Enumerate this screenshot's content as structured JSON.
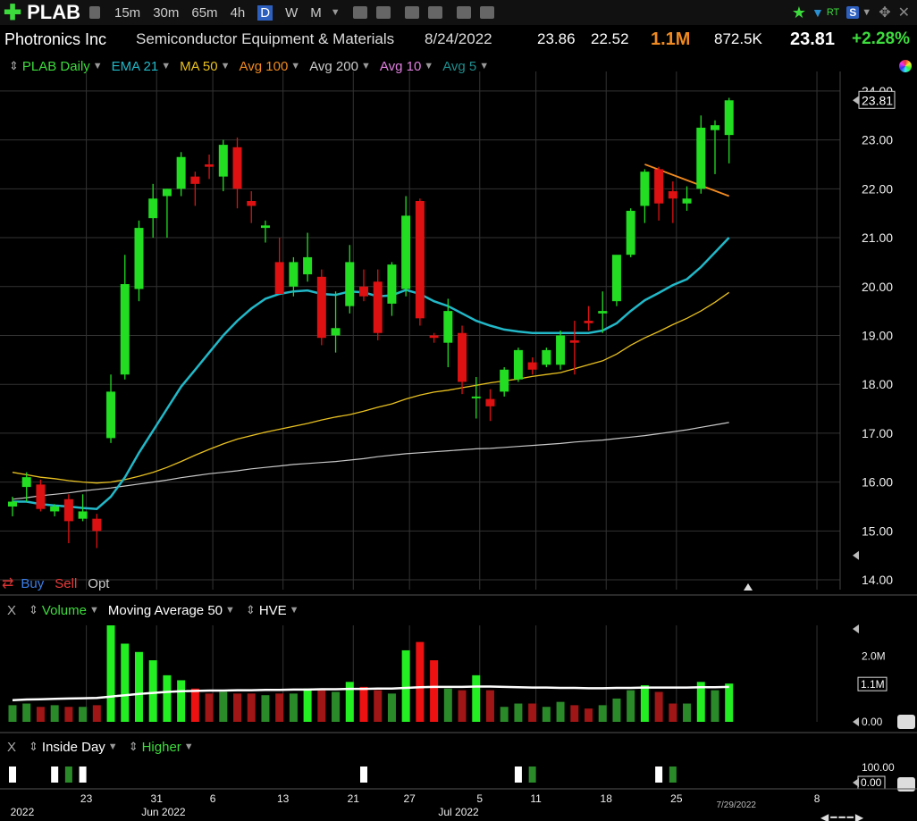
{
  "toolbar": {
    "symbol": "PLAB",
    "timeframes": [
      {
        "label": "15m",
        "active": false
      },
      {
        "label": "30m",
        "active": false
      },
      {
        "label": "65m",
        "active": false
      },
      {
        "label": "4h",
        "active": false
      },
      {
        "label": "D",
        "active": true
      },
      {
        "label": "W",
        "active": false
      },
      {
        "label": "M",
        "active": false
      }
    ],
    "rt_label": "RT",
    "s_label": "S"
  },
  "quote": {
    "company": "Photronics Inc",
    "industry": "Semiconductor Equipment & Materials",
    "date": "8/24/2022",
    "high": "23.86",
    "low": "22.52",
    "volume": "1.1M",
    "avg_volume": "872.5K",
    "last": "23.81",
    "change": "+2.28%"
  },
  "studies": [
    {
      "label": "PLAB Daily",
      "color": "#3ddc3d"
    },
    {
      "label": "EMA 21",
      "color": "#22b8c8"
    },
    {
      "label": "MA 50",
      "color": "#e8c020"
    },
    {
      "label": "Avg 100",
      "color": "#f08a20"
    },
    {
      "label": "Avg 200",
      "color": "#cccccc"
    },
    {
      "label": "Avg 10",
      "color": "#e080e0"
    },
    {
      "label": "Avg 5",
      "color": "#1f8f8f"
    }
  ],
  "orders": {
    "buy": "Buy",
    "sell": "Sell",
    "opt": "Opt"
  },
  "volume_header": {
    "x": "X",
    "volume": "Volume",
    "ma": "Moving Average 50",
    "hve": "HVE"
  },
  "indicator_header": {
    "x": "X",
    "inside": "Inside Day",
    "higher": "Higher"
  },
  "colors": {
    "up": "#22dd22",
    "down": "#dd1111",
    "ema21": "#22b8c8",
    "ma50": "#e8c020",
    "avg200": "#c8c8c8",
    "trend": "#f08a20",
    "grid": "#333333"
  },
  "chart_data": {
    "type": "candlestick",
    "ylim": [
      13.8,
      24.4
    ],
    "y_ticks": [
      14,
      15,
      16,
      17,
      18,
      19,
      20,
      21,
      22,
      23,
      24
    ],
    "y_tick_labels": [
      "14.00",
      "15.00",
      "16.00",
      "17.00",
      "18.00",
      "19.00",
      "20.00",
      "21.00",
      "22.00",
      "23.00",
      "24.00"
    ],
    "last_price_label": "23.81",
    "x_labels": [
      {
        "label": "23",
        "i": 5
      },
      {
        "label": "31",
        "i": 10
      },
      {
        "label": "6",
        "i": 14
      },
      {
        "label": "13",
        "i": 19
      },
      {
        "label": "21",
        "i": 24
      },
      {
        "label": "27",
        "i": 28
      },
      {
        "label": "5",
        "i": 33
      },
      {
        "label": "11",
        "i": 37
      },
      {
        "label": "18",
        "i": 42
      },
      {
        "label": "25",
        "i": 47
      },
      {
        "label": "8",
        "i": 57
      }
    ],
    "sub_labels": [
      {
        "label": "2022",
        "i": 0.1
      },
      {
        "label": "Jun 2022",
        "i": 11
      },
      {
        "label": "Jul 2022",
        "i": 32
      },
      {
        "label": "7/29/2022",
        "i": 51
      }
    ],
    "candles": [
      {
        "o": 15.5,
        "h": 15.7,
        "l": 15.3,
        "c": 15.6
      },
      {
        "o": 15.9,
        "h": 16.2,
        "l": 15.6,
        "c": 16.1
      },
      {
        "o": 15.95,
        "h": 16.05,
        "l": 15.4,
        "c": 15.45
      },
      {
        "o": 15.4,
        "h": 15.55,
        "l": 15.3,
        "c": 15.5
      },
      {
        "o": 15.65,
        "h": 15.75,
        "l": 14.75,
        "c": 15.2
      },
      {
        "o": 15.25,
        "h": 15.75,
        "l": 15.2,
        "c": 15.4
      },
      {
        "o": 15.25,
        "h": 15.35,
        "l": 14.65,
        "c": 15.0
      },
      {
        "o": 16.9,
        "h": 18.2,
        "l": 16.8,
        "c": 17.85
      },
      {
        "o": 18.2,
        "h": 20.65,
        "l": 18.1,
        "c": 20.05
      },
      {
        "o": 19.95,
        "h": 21.35,
        "l": 19.7,
        "c": 21.2
      },
      {
        "o": 21.4,
        "h": 22.1,
        "l": 21.0,
        "c": 21.8
      },
      {
        "o": 21.85,
        "h": 22.0,
        "l": 21.0,
        "c": 22.0
      },
      {
        "o": 22.0,
        "h": 22.75,
        "l": 21.85,
        "c": 22.65
      },
      {
        "o": 22.25,
        "h": 22.35,
        "l": 21.65,
        "c": 22.1
      },
      {
        "o": 22.5,
        "h": 22.7,
        "l": 22.2,
        "c": 22.45
      },
      {
        "o": 22.25,
        "h": 23.0,
        "l": 21.95,
        "c": 22.9
      },
      {
        "o": 22.85,
        "h": 23.05,
        "l": 21.6,
        "c": 22.0
      },
      {
        "o": 21.75,
        "h": 21.95,
        "l": 21.3,
        "c": 21.65
      },
      {
        "o": 21.2,
        "h": 21.35,
        "l": 20.9,
        "c": 21.25
      },
      {
        "o": 20.5,
        "h": 21.0,
        "l": 19.85,
        "c": 19.85
      },
      {
        "o": 20.0,
        "h": 20.6,
        "l": 19.8,
        "c": 20.5
      },
      {
        "o": 20.25,
        "h": 21.1,
        "l": 20.1,
        "c": 20.6
      },
      {
        "o": 20.2,
        "h": 20.35,
        "l": 18.8,
        "c": 18.95
      },
      {
        "o": 19.0,
        "h": 19.9,
        "l": 18.65,
        "c": 19.15
      },
      {
        "o": 19.6,
        "h": 20.85,
        "l": 19.45,
        "c": 20.5
      },
      {
        "o": 20.0,
        "h": 20.35,
        "l": 19.7,
        "c": 19.8
      },
      {
        "o": 20.1,
        "h": 20.35,
        "l": 18.9,
        "c": 19.05
      },
      {
        "o": 19.65,
        "h": 20.5,
        "l": 19.4,
        "c": 20.45
      },
      {
        "o": 19.95,
        "h": 21.85,
        "l": 19.8,
        "c": 21.45
      },
      {
        "o": 21.75,
        "h": 21.8,
        "l": 19.2,
        "c": 19.35
      },
      {
        "o": 19.0,
        "h": 19.05,
        "l": 18.85,
        "c": 18.95
      },
      {
        "o": 18.85,
        "h": 19.75,
        "l": 18.35,
        "c": 19.5
      },
      {
        "o": 19.05,
        "h": 19.2,
        "l": 17.8,
        "c": 18.05
      },
      {
        "o": 17.75,
        "h": 18.15,
        "l": 17.3,
        "c": 17.75
      },
      {
        "o": 17.7,
        "h": 17.9,
        "l": 17.25,
        "c": 17.55
      },
      {
        "o": 17.85,
        "h": 18.35,
        "l": 17.75,
        "c": 18.3
      },
      {
        "o": 18.1,
        "h": 18.75,
        "l": 18.05,
        "c": 18.7
      },
      {
        "o": 18.45,
        "h": 18.55,
        "l": 18.2,
        "c": 18.3
      },
      {
        "o": 18.4,
        "h": 18.75,
        "l": 18.35,
        "c": 18.7
      },
      {
        "o": 18.4,
        "h": 19.1,
        "l": 18.3,
        "c": 19.0
      },
      {
        "o": 18.9,
        "h": 19.3,
        "l": 18.2,
        "c": 18.85
      },
      {
        "o": 19.3,
        "h": 19.6,
        "l": 19.1,
        "c": 19.25
      },
      {
        "o": 19.45,
        "h": 19.9,
        "l": 19.05,
        "c": 19.5
      },
      {
        "o": 19.7,
        "h": 20.55,
        "l": 19.6,
        "c": 20.65
      },
      {
        "o": 20.65,
        "h": 21.6,
        "l": 20.6,
        "c": 21.55
      },
      {
        "o": 21.65,
        "h": 22.4,
        "l": 21.3,
        "c": 22.35
      },
      {
        "o": 22.4,
        "h": 22.45,
        "l": 21.35,
        "c": 21.7
      },
      {
        "o": 21.95,
        "h": 22.15,
        "l": 21.3,
        "c": 21.8
      },
      {
        "o": 21.7,
        "h": 22.05,
        "l": 21.55,
        "c": 21.8
      },
      {
        "o": 22.0,
        "h": 23.5,
        "l": 21.9,
        "c": 23.25
      },
      {
        "o": 23.2,
        "h": 23.4,
        "l": 22.3,
        "c": 23.3
      },
      {
        "o": 23.1,
        "h": 23.86,
        "l": 22.52,
        "c": 23.81
      }
    ],
    "ema21": [
      15.6,
      15.6,
      15.55,
      15.52,
      15.5,
      15.47,
      15.45,
      15.7,
      16.1,
      16.6,
      17.05,
      17.5,
      17.95,
      18.3,
      18.65,
      19.0,
      19.3,
      19.55,
      19.75,
      19.85,
      19.9,
      19.92,
      19.85,
      19.83,
      19.9,
      19.88,
      19.8,
      19.82,
      19.93,
      19.85,
      19.7,
      19.6,
      19.45,
      19.3,
      19.2,
      19.12,
      19.08,
      19.05,
      19.05,
      19.05,
      19.05,
      19.05,
      19.1,
      19.25,
      19.5,
      19.72,
      19.87,
      20.03,
      20.15,
      20.4,
      20.7,
      21.0
    ],
    "ma50": [
      16.2,
      16.15,
      16.1,
      16.07,
      16.03,
      16.0,
      15.98,
      16.0,
      16.05,
      16.12,
      16.2,
      16.3,
      16.42,
      16.55,
      16.67,
      16.78,
      16.88,
      16.95,
      17.02,
      17.08,
      17.14,
      17.2,
      17.27,
      17.33,
      17.38,
      17.45,
      17.53,
      17.6,
      17.7,
      17.78,
      17.84,
      17.88,
      17.93,
      17.98,
      18.03,
      18.07,
      18.11,
      18.16,
      18.2,
      18.24,
      18.32,
      18.4,
      18.48,
      18.62,
      18.8,
      18.95,
      19.08,
      19.22,
      19.35,
      19.5,
      19.68,
      19.88
    ],
    "avg200": [
      15.65,
      15.68,
      15.72,
      15.75,
      15.78,
      15.82,
      15.85,
      15.88,
      15.92,
      15.96,
      16.0,
      16.04,
      16.09,
      16.13,
      16.17,
      16.2,
      16.23,
      16.27,
      16.3,
      16.33,
      16.36,
      16.38,
      16.4,
      16.42,
      16.45,
      16.48,
      16.52,
      16.55,
      16.58,
      16.6,
      16.62,
      16.64,
      16.66,
      16.68,
      16.69,
      16.71,
      16.73,
      16.75,
      16.77,
      16.79,
      16.82,
      16.84,
      16.86,
      16.89,
      16.92,
      16.95,
      16.99,
      17.03,
      17.07,
      17.12,
      17.17,
      17.22
    ],
    "trendline": [
      {
        "i": 45,
        "y": 22.5
      },
      {
        "i": 51,
        "y": 21.85
      }
    ],
    "volume": {
      "ylim": [
        0,
        2.9
      ],
      "y_tick_labels": [
        "0.00",
        "2.0M"
      ],
      "last_label": "1.1M",
      "values": [
        0.5,
        0.55,
        0.45,
        0.5,
        0.45,
        0.45,
        0.5,
        2.9,
        2.35,
        2.1,
        1.85,
        1.4,
        1.25,
        1.0,
        0.85,
        0.9,
        0.85,
        0.85,
        0.8,
        0.85,
        0.85,
        1.0,
        0.95,
        0.9,
        1.2,
        1.05,
        0.95,
        0.85,
        2.15,
        2.4,
        1.85,
        1.0,
        0.95,
        1.4,
        0.95,
        0.45,
        0.55,
        0.55,
        0.45,
        0.6,
        0.5,
        0.4,
        0.5,
        0.7,
        0.95,
        1.1,
        0.9,
        0.55,
        0.55,
        1.2,
        0.95,
        1.15
      ],
      "ma50": [
        0.65,
        0.67,
        0.68,
        0.69,
        0.7,
        0.71,
        0.72,
        0.76,
        0.8,
        0.84,
        0.87,
        0.9,
        0.92,
        0.93,
        0.94,
        0.94,
        0.95,
        0.95,
        0.96,
        0.96,
        0.97,
        0.97,
        0.98,
        0.98,
        0.99,
        0.99,
        1.0,
        1.0,
        1.02,
        1.04,
        1.05,
        1.05,
        1.05,
        1.06,
        1.06,
        1.05,
        1.04,
        1.03,
        1.03,
        1.02,
        1.02,
        1.01,
        1.01,
        1.02,
        1.02,
        1.03,
        1.03,
        1.03,
        1.03,
        1.04,
        1.04,
        1.05
      ]
    },
    "inside_day": {
      "y_tick_labels": [
        "0.00",
        "100.00"
      ],
      "last_label": "0.00",
      "values": [
        {
          "i": 0,
          "c": "white"
        },
        {
          "i": 3,
          "c": "white"
        },
        {
          "i": 4,
          "c": "green"
        },
        {
          "i": 5,
          "c": "white"
        },
        {
          "i": 25,
          "c": "white"
        },
        {
          "i": 36,
          "c": "white"
        },
        {
          "i": 37,
          "c": "green"
        },
        {
          "i": 46,
          "c": "white"
        },
        {
          "i": 47,
          "c": "green"
        }
      ]
    }
  }
}
